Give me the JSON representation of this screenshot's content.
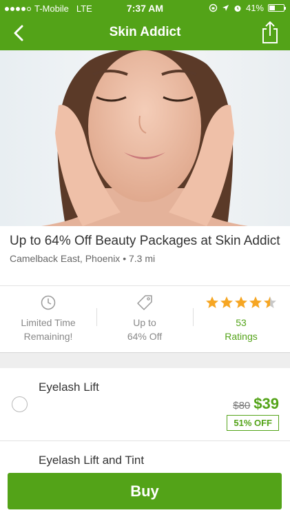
{
  "status_bar": {
    "carrier": "T-Mobile",
    "network": "LTE",
    "time": "7:37 AM",
    "battery": "41%",
    "battery_level": 0.41
  },
  "nav": {
    "title": "Skin Addict",
    "back_icon": "chevron-left-icon",
    "share_icon": "share-icon"
  },
  "deal": {
    "title": "Up to 64% Off Beauty Packages at Skin Addict",
    "location": "Camelback East, Phoenix • 7.3 mi"
  },
  "stats": {
    "time": {
      "icon": "clock-icon",
      "line1": "Limited Time",
      "line2": "Remaining!"
    },
    "discount": {
      "icon": "tag-icon",
      "line1": "Up to",
      "line2": "64% Off"
    },
    "ratings": {
      "stars": 4.5,
      "count": "53",
      "label": "Ratings"
    }
  },
  "options": [
    {
      "name": "Eyelash Lift",
      "old_price": "$80",
      "new_price": "$39",
      "discount": "51% OFF"
    },
    {
      "name": "Eyelash Lift and Tint"
    }
  ],
  "buy_label": "Buy",
  "colors": {
    "brand_green": "#53a318",
    "star": "#f6a623"
  }
}
